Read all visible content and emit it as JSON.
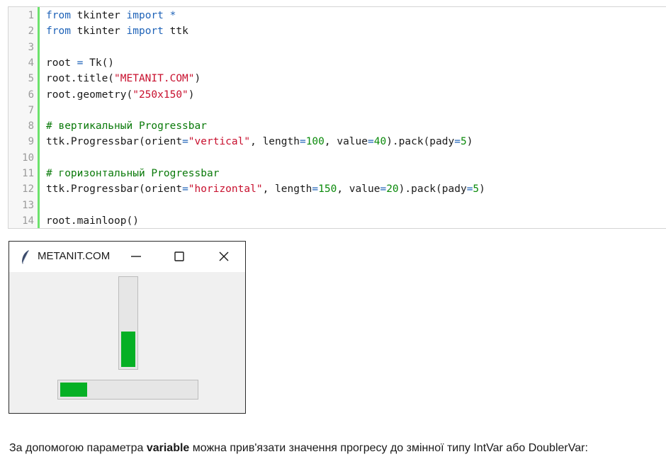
{
  "code": {
    "lines": [
      {
        "n": "1",
        "parts": [
          {
            "t": "from",
            "c": "kw"
          },
          {
            "t": " tkinter ",
            "c": ""
          },
          {
            "t": "import",
            "c": "kw"
          },
          {
            "t": " *",
            "c": "op"
          }
        ]
      },
      {
        "n": "2",
        "parts": [
          {
            "t": "from",
            "c": "kw"
          },
          {
            "t": " tkinter ",
            "c": ""
          },
          {
            "t": "import",
            "c": "kw"
          },
          {
            "t": " ttk",
            "c": ""
          }
        ]
      },
      {
        "n": "3",
        "parts": []
      },
      {
        "n": "4",
        "parts": [
          {
            "t": "root ",
            "c": ""
          },
          {
            "t": "=",
            "c": "op"
          },
          {
            "t": " Tk()",
            "c": ""
          }
        ]
      },
      {
        "n": "5",
        "parts": [
          {
            "t": "root.title(",
            "c": ""
          },
          {
            "t": "\"METANIT.COM\"",
            "c": "str"
          },
          {
            "t": ")",
            "c": ""
          }
        ]
      },
      {
        "n": "6",
        "parts": [
          {
            "t": "root.geometry(",
            "c": ""
          },
          {
            "t": "\"250x150\"",
            "c": "str"
          },
          {
            "t": ")",
            "c": ""
          }
        ]
      },
      {
        "n": "7",
        "parts": []
      },
      {
        "n": "8",
        "parts": [
          {
            "t": "# вертикальный Progressbar",
            "c": "cmt"
          }
        ]
      },
      {
        "n": "9",
        "parts": [
          {
            "t": "ttk.Progressbar(orient",
            "c": ""
          },
          {
            "t": "=",
            "c": "op"
          },
          {
            "t": "\"vertical\"",
            "c": "str"
          },
          {
            "t": ", length",
            "c": ""
          },
          {
            "t": "=",
            "c": "op"
          },
          {
            "t": "100",
            "c": "num"
          },
          {
            "t": ", value",
            "c": ""
          },
          {
            "t": "=",
            "c": "op"
          },
          {
            "t": "40",
            "c": "num"
          },
          {
            "t": ").pack(pady",
            "c": ""
          },
          {
            "t": "=",
            "c": "op"
          },
          {
            "t": "5",
            "c": "num"
          },
          {
            "t": ")",
            "c": ""
          }
        ]
      },
      {
        "n": "10",
        "parts": []
      },
      {
        "n": "11",
        "parts": [
          {
            "t": "# горизонтальный Progressbar",
            "c": "cmt"
          }
        ]
      },
      {
        "n": "12",
        "parts": [
          {
            "t": "ttk.Progressbar(orient",
            "c": ""
          },
          {
            "t": "=",
            "c": "op"
          },
          {
            "t": "\"horizontal\"",
            "c": "str"
          },
          {
            "t": ", length",
            "c": ""
          },
          {
            "t": "=",
            "c": "op"
          },
          {
            "t": "150",
            "c": "num"
          },
          {
            "t": ", value",
            "c": ""
          },
          {
            "t": "=",
            "c": "op"
          },
          {
            "t": "20",
            "c": "num"
          },
          {
            "t": ").pack(pady",
            "c": ""
          },
          {
            "t": "=",
            "c": "op"
          },
          {
            "t": "5",
            "c": "num"
          },
          {
            "t": ")",
            "c": ""
          }
        ]
      },
      {
        "n": "13",
        "parts": []
      },
      {
        "n": "14",
        "parts": [
          {
            "t": "root.mainloop()",
            "c": ""
          }
        ]
      }
    ]
  },
  "window": {
    "title": "METANIT.COM",
    "icon": "feather-icon",
    "controls": [
      "minimize-icon",
      "maximize-icon",
      "close-icon"
    ],
    "vertical_progress": 0.4,
    "horizontal_progress": 0.2,
    "fill_color": "#06b025",
    "trough_color": "#e6e6e6"
  },
  "paragraph": {
    "before": "За допомогою параметра ",
    "bold": "variable",
    "after": " можна прив'язати значення прогресу до змінної типу IntVar або DoublerVar:"
  }
}
